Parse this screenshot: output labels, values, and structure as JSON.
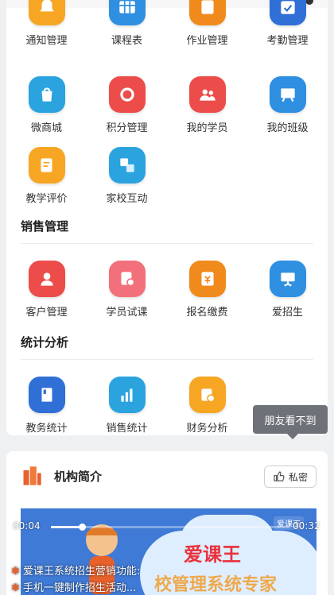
{
  "colors": {
    "orange": "#f7a623",
    "orange_deep": "#f08a1c",
    "blue": "#2f8fe0",
    "red": "#ec4d4a",
    "pink": "#f2707b",
    "teal": "#2aa3df"
  },
  "row1": [
    {
      "label": "通知管理",
      "icon": "bell-icon",
      "color": "#f7a623"
    },
    {
      "label": "课程表",
      "icon": "grid-icon",
      "color": "#2f8fe0"
    },
    {
      "label": "作业管理",
      "icon": "book-icon",
      "color": "#f08a1c"
    },
    {
      "label": "考勤管理",
      "icon": "calendar-check-icon",
      "color": "#2f6fd6"
    }
  ],
  "row2": [
    {
      "label": "微商城",
      "icon": "shopping-bag-icon",
      "color": "#2aa3df"
    },
    {
      "label": "积分管理",
      "icon": "points-badge-icon",
      "color": "#ec4d4a"
    },
    {
      "label": "我的学员",
      "icon": "students-icon",
      "color": "#ec4d4a"
    },
    {
      "label": "我的班级",
      "icon": "classroom-board-icon",
      "color": "#2f8fe0"
    }
  ],
  "row3": [
    {
      "label": "教学评价",
      "icon": "edit-note-icon",
      "color": "#f7a623"
    },
    {
      "label": "家校互动",
      "icon": "exchange-icon",
      "color": "#2aa3df"
    }
  ],
  "sales": {
    "title": "销售管理",
    "items": [
      {
        "label": "客户管理",
        "icon": "customer-crm-icon",
        "color": "#ec4d4a"
      },
      {
        "label": "学员试课",
        "icon": "trial-class-icon",
        "color": "#f2707b"
      },
      {
        "label": "报名缴费",
        "icon": "payment-icon",
        "color": "#f08a1c"
      },
      {
        "label": "爱招生",
        "icon": "presentation-icon",
        "color": "#2f8fe0"
      }
    ]
  },
  "stats": {
    "title": "统计分析",
    "items": [
      {
        "label": "教务统计",
        "icon": "report-book-icon",
        "color": "#2f6fd6"
      },
      {
        "label": "销售统计",
        "icon": "bar-chart-icon",
        "color": "#2aa3df"
      },
      {
        "label": "财务分析",
        "icon": "finance-icon",
        "color": "#f7a623"
      }
    ]
  },
  "tooltip": "朋友看不到",
  "intro": {
    "title": "机构简介",
    "private_label": "私密"
  },
  "video": {
    "current_time": "00:04",
    "total_time": "00:32",
    "progress": 0.13,
    "brand_text": "爱课王",
    "sub_text": "校管理系统专家",
    "logo_text": "爱课王"
  },
  "captions": [
    "爱课王系统招生营销功能:",
    "手机一键制作招生活动..."
  ]
}
